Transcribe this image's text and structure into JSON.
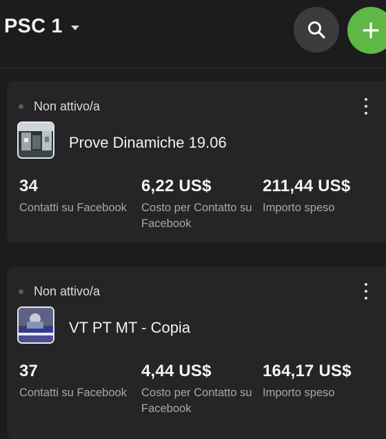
{
  "header": {
    "account_name": "PSC 1",
    "icons": {
      "dropdown": "caret-down-icon",
      "search": "search-icon",
      "add": "plus-icon"
    },
    "colors": {
      "add_button": "#5fb846",
      "search_button": "#3c3c3e"
    }
  },
  "campaigns": [
    {
      "status": "Non attivo/a",
      "name": "Prove Dinamiche 19.06",
      "thumbnail": "campaign-thumbnail",
      "metrics": [
        {
          "value": "34",
          "label": "Contatti su Facebook"
        },
        {
          "value": "6,22 US$",
          "label": "Costo per Contatto su Facebook"
        },
        {
          "value": "211,44 US$",
          "label": "Importo speso"
        }
      ]
    },
    {
      "status": "Non attivo/a",
      "name": "VT PT MT - Copia",
      "thumbnail": "campaign-thumbnail",
      "metrics": [
        {
          "value": "37",
          "label": "Contatti su Facebook"
        },
        {
          "value": "4,44 US$",
          "label": "Costo per Contatto su Facebook"
        },
        {
          "value": "164,17 US$",
          "label": "Importo speso"
        }
      ]
    }
  ]
}
